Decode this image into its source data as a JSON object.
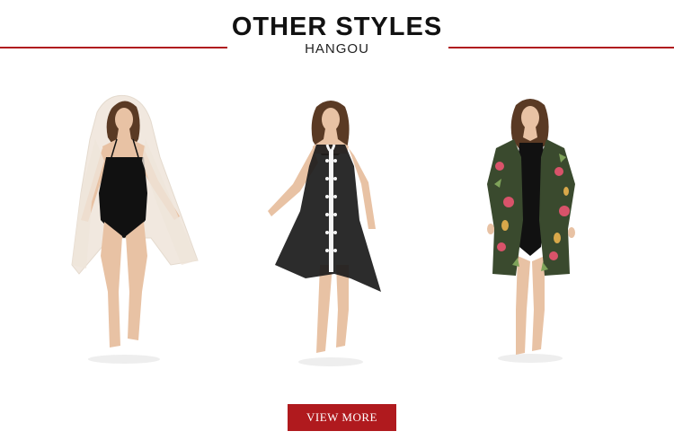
{
  "header": {
    "title": "OTHER STYLES",
    "subtitle": "HANGOU"
  },
  "products": [
    {
      "name": "white-lace-hooded-cover-up-black-swimsuit",
      "cover_color": "#efe5da",
      "suit_color": "#111111"
    },
    {
      "name": "black-chiffon-cover-up-white-lace-trim",
      "cover_color": "#1a1a1a",
      "trim_color": "#f5f5f5"
    },
    {
      "name": "floral-print-kimono-cover-up",
      "cover_color": "#3a4a2e",
      "accent_color": "#d9536a"
    }
  ],
  "cta": {
    "label": "VIEW MORE",
    "color": "#b01a1e"
  },
  "colors": {
    "accent": "#b01a1e",
    "skin": "#e8c2a4",
    "hair": "#5a3a24"
  }
}
